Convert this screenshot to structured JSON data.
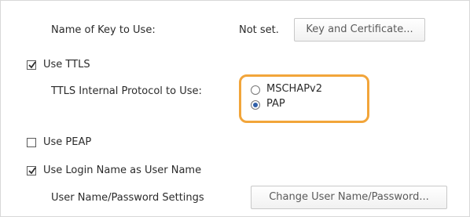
{
  "form": {
    "key_label": "Name of Key to Use:",
    "key_value": "Not set.",
    "key_button": "Key and Certificate...",
    "use_ttls_label": "Use TTLS",
    "use_ttls_checked": true,
    "ttls_protocol_label": "TTLS Internal Protocol to Use:",
    "protocol_options": [
      {
        "label": "MSCHAPv2",
        "selected": false
      },
      {
        "label": "PAP",
        "selected": true
      }
    ],
    "use_peap_label": "Use PEAP",
    "use_peap_checked": false,
    "use_login_label": "Use Login Name as User Name",
    "use_login_checked": true,
    "user_settings_label": "User Name/Password Settings",
    "change_user_button": "Change User Name/Password..."
  },
  "colors": {
    "highlight": "#f2a53a",
    "radio_selected": "#2f5fa8"
  }
}
